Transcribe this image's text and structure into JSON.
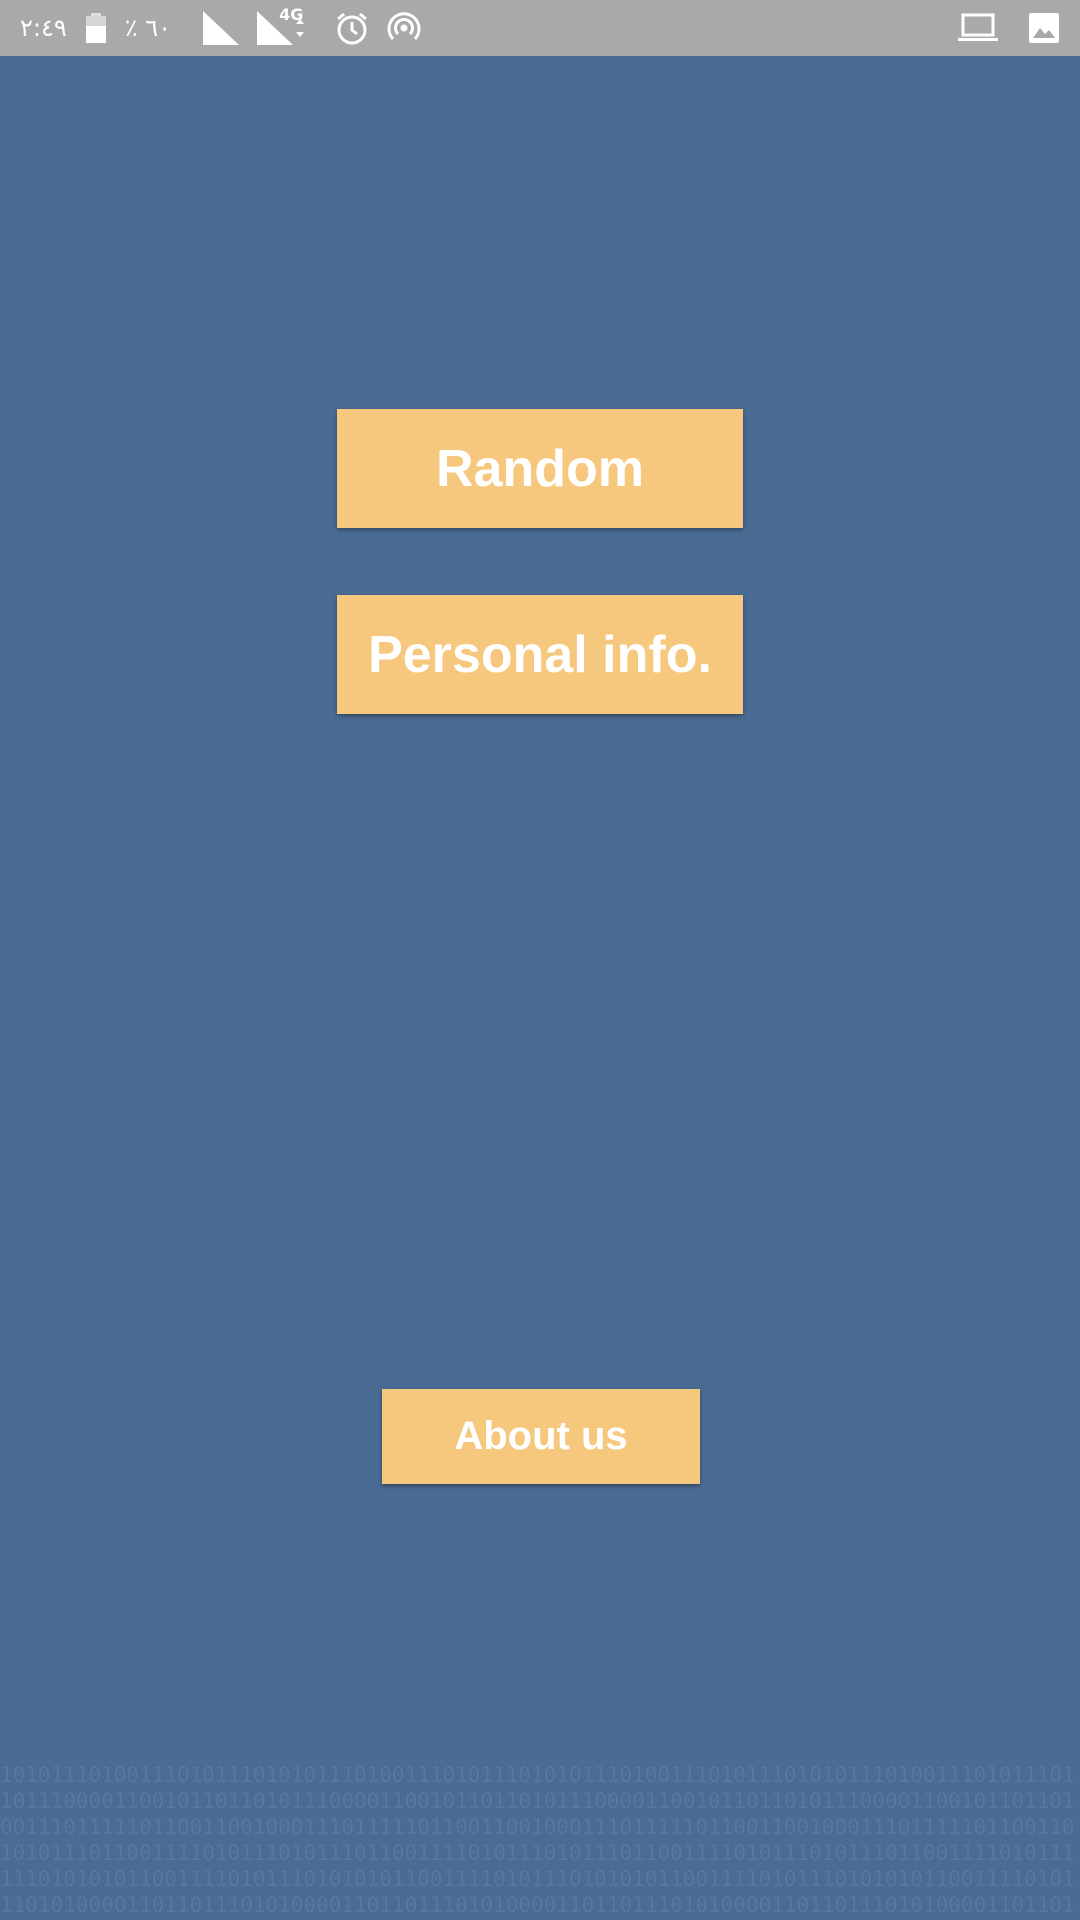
{
  "status_bar": {
    "time": "٢:٤٩",
    "battery_percent": "٪ ٦٠",
    "network_type": "4G",
    "icons": [
      "battery-icon",
      "signal-icon",
      "signal-4g-icon",
      "alarm-icon",
      "hotspot-icon",
      "laptop-icon",
      "image-icon"
    ]
  },
  "colors": {
    "background": "#4a6b93",
    "button": "#f6c87e",
    "button_text": "#ffffff",
    "status_bar": "#a9a9a9"
  },
  "buttons": {
    "random": "Random",
    "personal_info": "Personal info.",
    "about_us": "About us"
  },
  "background_pattern": {
    "rows": [
      "1010111010011101011101010111010011101011101010111010011101011101010111010011101011101",
      "1011100001100101101101011100001100101101101011100001100101101101011100001100101101101",
      "0011101111101100110010001110111110110011001000111011111011001100100011101111101100110",
      "1010111011001111010111010111011001111010111010111011001111010111010111011001111010111",
      "1110101010110011110101110101010110011110101110101010110011110101110101010110011110101",
      "1101010000110110111010100001101101110101000011011011101010000110110111010100001101101"
    ]
  }
}
